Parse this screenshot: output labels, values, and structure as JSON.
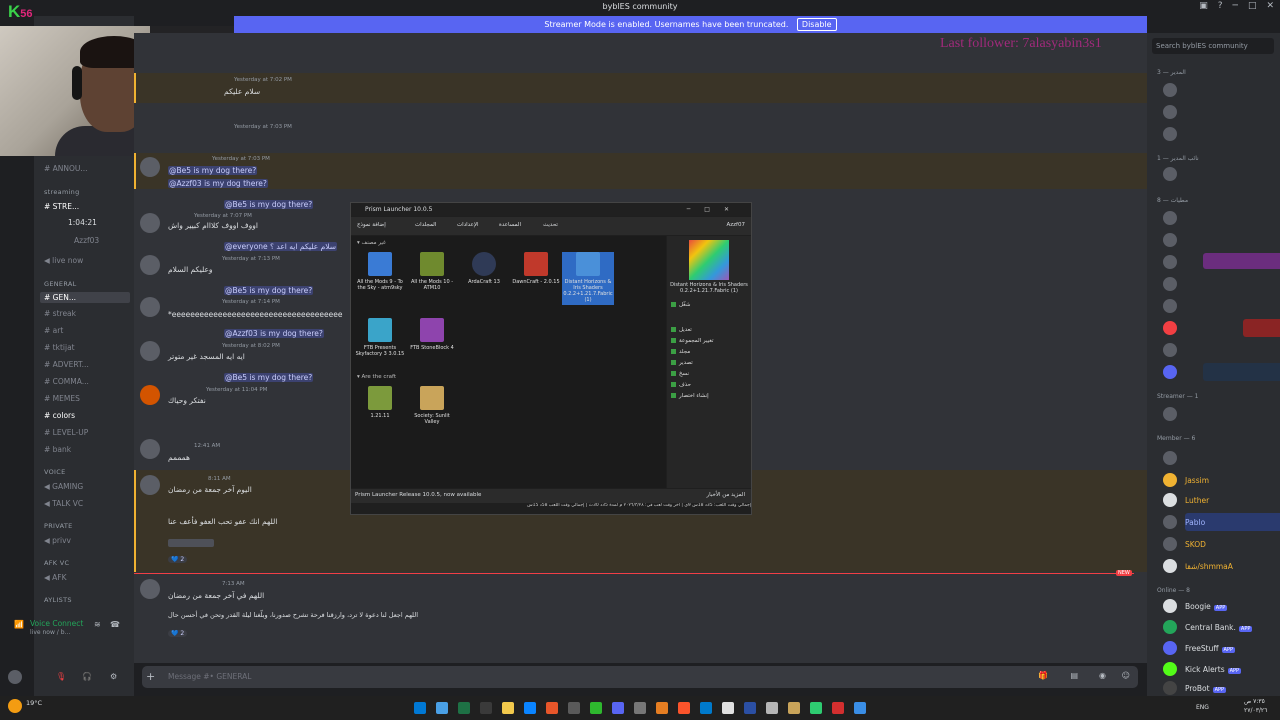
{
  "app": {
    "window_title": "byblES community",
    "streamer_notice": "Streamer Mode is enabled. Usernames have been truncated.",
    "disable_label": "Disable",
    "overlay_logo_letter": "K",
    "overlay_logo_number": "56",
    "last_follower": "Last follower: 7alasyabin3s1"
  },
  "sidebar": {
    "categories": [
      "streaming",
      "GENERAL",
      "VOICE",
      "PRIVATE",
      "AFK VC",
      "AYLISTS"
    ],
    "channels": [
      {
        "name": "ANNOU..."
      },
      {
        "name": "STRE..."
      },
      {
        "name": "live now"
      },
      {
        "name": "GEN...",
        "active": true
      },
      {
        "name": "streak"
      },
      {
        "name": "art"
      },
      {
        "name": "tktijat"
      },
      {
        "name": "ADVERT..."
      },
      {
        "name": "COMMA..."
      },
      {
        "name": "MEMES"
      },
      {
        "name": "colors"
      },
      {
        "name": "LEVEL-UP"
      },
      {
        "name": "bank"
      },
      {
        "name": "GAMING"
      },
      {
        "name": "TALK VC"
      },
      {
        "name": "privv"
      },
      {
        "name": "AFK"
      }
    ],
    "voice_user": "Azzf03",
    "voice_timer": "1:04:21",
    "voice_connect": "Voice Connect",
    "voice_sub": "live now / b..."
  },
  "chat": {
    "messages": [
      {
        "time": "Yesterday at 7:02 PM",
        "text": "سلام عليكم"
      },
      {
        "time": "Yesterday at 7:03 PM",
        "text": ""
      },
      {
        "time": "Yesterday at 7:03 PM",
        "text": "@Be5 is my dog there?"
      },
      {
        "time": "",
        "text": "@Azzf03 is my dog there?"
      },
      {
        "time": "",
        "text": "@Be5 is my dog there?"
      },
      {
        "time": "Yesterday at 7:07 PM",
        "text": "اووف اووف كلااام كبيير واش"
      },
      {
        "time": "",
        "text": "@everyone سلام عليكم ايه اعد ؟"
      },
      {
        "time": "Yesterday at 7:13 PM",
        "text": "وعليكم السلام"
      },
      {
        "time": "",
        "text": "@Be5 is my dog there?"
      },
      {
        "time": "Yesterday at 7:14 PM",
        "text": "*eeeeeeeeeeeeeeeeeeeeeeeeeeeeeeeeeeeee"
      },
      {
        "time": "",
        "text": "@Azzf03 is my dog there?"
      },
      {
        "time": "Yesterday at 8:02 PM",
        "text": "ايه ايه المسجد غير متوتر"
      },
      {
        "time": "",
        "text": "@Be5 is my dog there?"
      },
      {
        "time": "Yesterday at 11:04 PM",
        "text": "نفتكر وحياك"
      },
      {
        "time": "12:41 AM",
        "text": "همممم"
      },
      {
        "time": "8:11 AM",
        "text": "اليوم آخر جمعة من رمضان"
      },
      {
        "time": "",
        "text": "اللهم انك عفو تحب العفو فأعف عنا"
      },
      {
        "time": "7:13 AM",
        "text": "اللهم في آخر جمعة من رمضان"
      },
      {
        "time": "",
        "text": "اللهم اجعل لنا دعوة لا ترد، وارزقنا فرحة تشرح صدورنا، وبلّغنا ليلة القدر وتحن في أحسن حال"
      }
    ],
    "reaction_count": "2",
    "new_label": "NEW",
    "composer_placeholder": "Message #• GENERAL"
  },
  "prism": {
    "title": "Prism Launcher 10.0.5",
    "toolbar": [
      "إضافة نموذج",
      "المجلدات",
      "الإعدادات",
      "المساعدة",
      "تحديث"
    ],
    "account": "Azzf07",
    "group1": "غير مصنف",
    "group2": "Are the craft",
    "instances": [
      {
        "label": "All the Mods 9 - To the Sky - atm9sky",
        "color": "#3a7bd5"
      },
      {
        "label": "All the Mods 10 - ATM10",
        "color": "#6f8a2e"
      },
      {
        "label": "ArdaCraft 13",
        "color": "#2f3a56"
      },
      {
        "label": "DawnCraft - 2.0.15",
        "color": "#c0392b"
      },
      {
        "label": "Distant Horizons & Iris Shaders 0.2.2+1.21.7.Fabric (1)",
        "color": "#4a90d9",
        "selected": true
      },
      {
        "label": "FTB Presents Skyfactory 3 3.0.15",
        "color": "#3aa4c9"
      },
      {
        "label": "FTB StoneBlock 4",
        "color": "#8e44ad"
      },
      {
        "label": "1.21.11",
        "color": "#7c9a3c"
      },
      {
        "label": "Society: Sunlit Valley",
        "color": "#c9a45a"
      }
    ],
    "side_title": "Distant Horizons & Iris Shaders 0.2.2+1.21.7.Fabric (1)",
    "side_actions": [
      "شغّل",
      "تعديل",
      "تغيير المجموعة",
      "مجلد",
      "تصدير",
      "نسخ",
      "حذف",
      "إنشاء اختصار"
    ],
    "status_left": "Prism Launcher Release 10.0.5, now available",
    "status_right": "المزيد من الأخبار",
    "playtime": "إجمالي وقت اللعب: 35د 18س 9ي | آخر وقت لعب في: ٢٠٢٦/٣/٢٨ م لمدة 35د 30ث | إجمالي وقت اللعب 58د 15س"
  },
  "members": {
    "search_placeholder": "Search byblES community",
    "groups": [
      {
        "header": "المدير — 3"
      },
      {
        "header": "نائب المدير — 1"
      },
      {
        "header": "مطيات — 8"
      },
      {
        "header": "Streamer — 1"
      },
      {
        "header": "Member — 6"
      },
      {
        "header": "Online — 8"
      }
    ],
    "list": [
      {
        "name": "Jassim",
        "color": "#f0b232"
      },
      {
        "name": "Luther",
        "color": "#f0b232"
      },
      {
        "name": "Pablo",
        "color": "#a0b4ff"
      },
      {
        "name": "SKOD",
        "color": "#f0b232"
      },
      {
        "name": "ﺷﻘﺎ/shmmaA",
        "color": "#f0b232"
      },
      {
        "name": "Boogie",
        "color": "#dbdee1"
      },
      {
        "name": "Central Bank.",
        "color": "#dbdee1"
      },
      {
        "name": "FreeStuff",
        "color": "#dbdee1"
      },
      {
        "name": "Kick Alerts",
        "color": "#dbdee1"
      },
      {
        "name": "ProBot",
        "color": "#dbdee1"
      }
    ],
    "app_tag": "APP"
  },
  "taskbar": {
    "weather": "19°C",
    "lang": "ENG",
    "clock_time": "٧:٣٥ ص",
    "clock_date": "٢٧/٠٣/٢٦"
  },
  "colors": {
    "accent": "#5865f2",
    "mention_bg": "#3c4270",
    "highlight": "#f0b232",
    "danger": "#f23f43"
  }
}
